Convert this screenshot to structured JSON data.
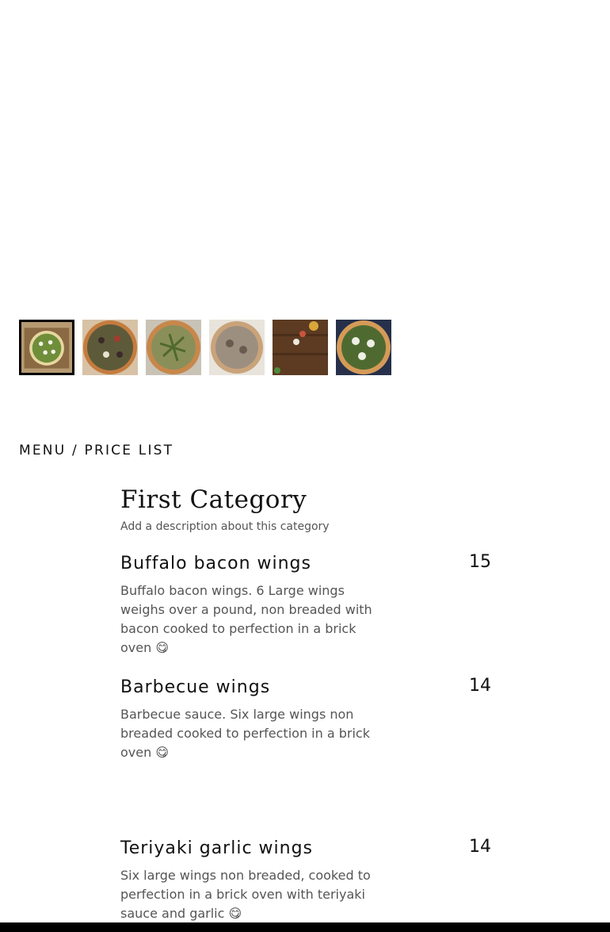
{
  "gallery": {
    "thumbnails": [
      {
        "name": "pizza-thumb-1",
        "active": true
      },
      {
        "name": "pizza-thumb-2",
        "active": false
      },
      {
        "name": "pizza-thumb-3",
        "active": false
      },
      {
        "name": "pizza-thumb-4",
        "active": false
      },
      {
        "name": "ingredients-thumb",
        "active": false
      },
      {
        "name": "pizza-thumb-6",
        "active": false
      }
    ]
  },
  "menu": {
    "heading": "MENU / PRICE LIST",
    "category": {
      "title": "First Category",
      "description": "Add a description about this category"
    },
    "items": [
      {
        "name": "Buffalo bacon wings",
        "price": "15",
        "description": "Buffalo bacon wings. 6 Large wings weighs over a pound, non breaded with bacon cooked to perfection in a brick oven 😋"
      },
      {
        "name": "Barbecue wings",
        "price": "14",
        "description": "Barbecue sauce. Six large wings non breaded cooked to perfection in a brick oven 😋"
      },
      {
        "name": "Teriyaki garlic wings",
        "price": "14",
        "description": "Six large wings  non breaded, cooked to perfection in a brick oven with teriyaki sauce and garlic 😋"
      }
    ]
  }
}
